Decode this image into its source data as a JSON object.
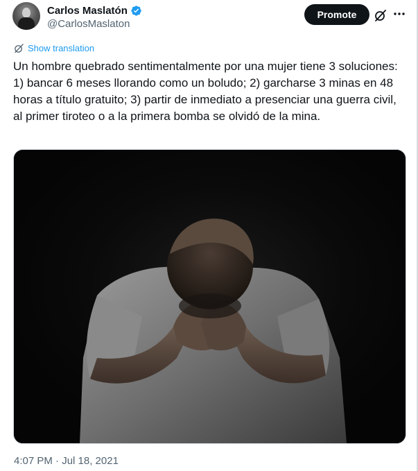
{
  "author": {
    "display_name": "Carlos Maslatón",
    "handle": "@CarlosMaslaton",
    "verified": true
  },
  "actions": {
    "promote_label": "Promote"
  },
  "translation": {
    "label": "Show translation"
  },
  "tweet": {
    "text": "Un hombre quebrado sentimentalmente por una mujer tiene 3 soluciones: 1) bancar 6 meses llorando como un boludo; 2) garcharse 3 minas en 48 horas a título gratuito; 3) partir de inmediato a presenciar una guerra civil, al primer tiroteo o a la primera bomba se olvidó de la mina.",
    "timestamp": "4:07 PM · Jul 18, 2021"
  },
  "colors": {
    "accent": "#1d9bf0",
    "text": "#0f1419",
    "secondary_text": "#536471",
    "button_bg": "#0f1419"
  },
  "icons": {
    "verified": "verified-badge-icon",
    "grok": "grok-icon",
    "more": "more-icon",
    "translate": "translate-icon"
  }
}
